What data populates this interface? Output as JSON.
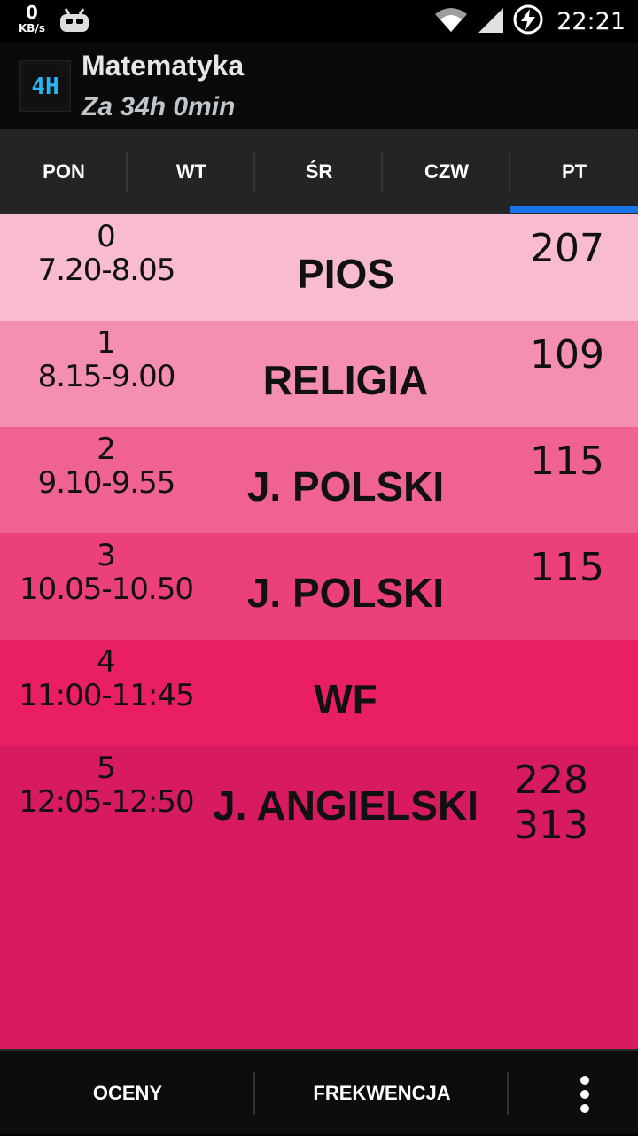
{
  "status_bar": {
    "net_speed_value": "0",
    "net_speed_unit": "KB/s",
    "notification_icon": "cyanogen-robot-icon",
    "icons": [
      "wifi-icon",
      "signal-icon",
      "battery-charging-icon"
    ],
    "time": "22:21"
  },
  "action_bar": {
    "app_icon": "4H",
    "title": "Matematyka",
    "subtitle": "Za 34h 0min"
  },
  "tabs": [
    {
      "label": "PON",
      "active": false
    },
    {
      "label": "WT",
      "active": false
    },
    {
      "label": "ŚR",
      "active": false
    },
    {
      "label": "CZW",
      "active": false
    },
    {
      "label": "PT",
      "active": true
    }
  ],
  "lessons": [
    {
      "no": "0",
      "time": "7.20-8.05",
      "subject": "PIOS",
      "rooms": [
        "207"
      ],
      "color": "#f8bbd0"
    },
    {
      "no": "1",
      "time": "8.15-9.00",
      "subject": "RELIGIA",
      "rooms": [
        "109"
      ],
      "color": "#f48fb1"
    },
    {
      "no": "2",
      "time": "9.10-9.55",
      "subject": "J. POLSKI",
      "rooms": [
        "115"
      ],
      "color": "#f06292"
    },
    {
      "no": "3",
      "time": "10.05-10.50",
      "subject": "J. POLSKI",
      "rooms": [
        "115"
      ],
      "color": "#ec407a"
    },
    {
      "no": "4",
      "time": "11:00-11:45",
      "subject": "WF",
      "rooms": [],
      "color": "#e91e63"
    },
    {
      "no": "5",
      "time": "12:05-12:50",
      "subject": "J. ANGIELSKI",
      "rooms": [
        "228",
        "313"
      ],
      "color": "#d81b60"
    }
  ],
  "bottom_bar": {
    "grades_label": "OCENY",
    "attendance_label": "FREKWENCJA",
    "overflow_icon": "more-vert-icon"
  }
}
